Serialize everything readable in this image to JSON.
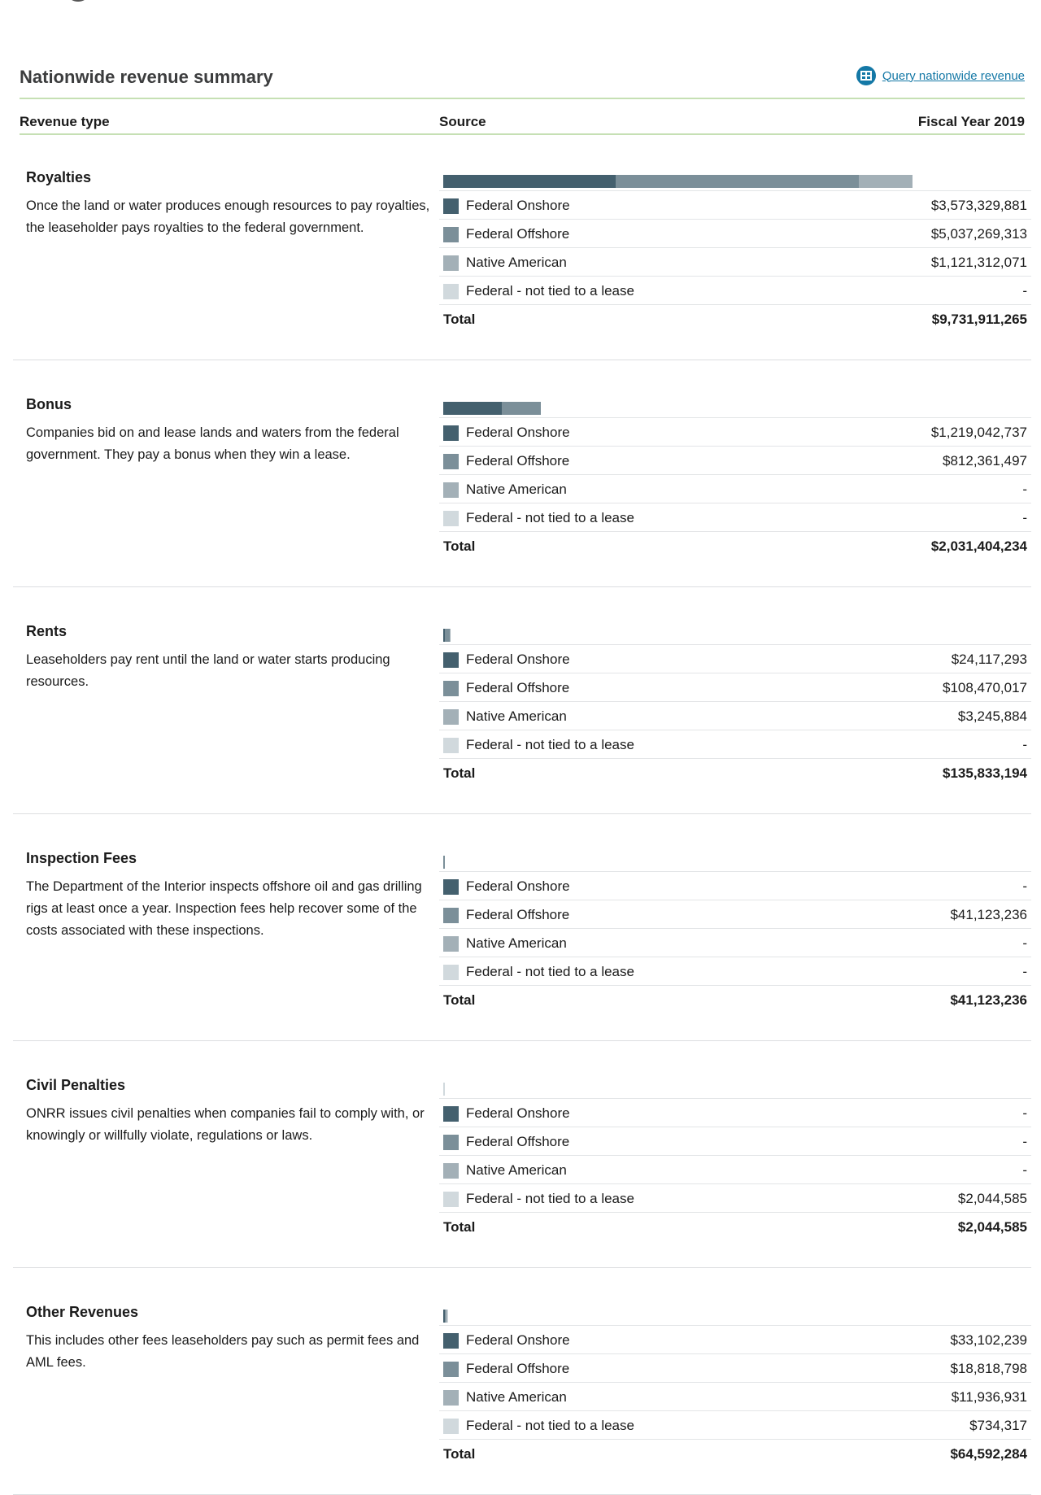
{
  "header": {
    "title": "Nationwide revenue summary",
    "query_link": "Query nationwide revenue"
  },
  "columns": {
    "type": "Revenue type",
    "source": "Source",
    "year": "Fiscal Year 2019"
  },
  "colors": {
    "federal_onshore": "#44606e",
    "federal_offshore": "#7b8f99",
    "native_american": "#a3b0b7",
    "federal_not_tied": "#d1d9dd",
    "header_rule": "#c6e0b4",
    "link": "#1478a6"
  },
  "max_total": 9731911265,
  "sections": [
    {
      "title": "Royalties",
      "desc": "Once the land or water produces enough resources to pay royalties, the leaseholder pays royalties to the federal government.",
      "rows": [
        {
          "label": "Federal Onshore",
          "display": "$3,573,329,881",
          "value": 3573329881
        },
        {
          "label": "Federal Offshore",
          "display": "$5,037,269,313",
          "value": 5037269313
        },
        {
          "label": "Native American",
          "display": "$1,121,312,071",
          "value": 1121312071
        },
        {
          "label": "Federal - not tied to a lease",
          "display": "-",
          "value": 0
        }
      ],
      "total_label": "Total",
      "total": "$9,731,911,265"
    },
    {
      "title": "Bonus",
      "desc": "Companies bid on and lease lands and waters from the federal government. They pay a bonus when they win a lease.",
      "rows": [
        {
          "label": "Federal Onshore",
          "display": "$1,219,042,737",
          "value": 1219042737
        },
        {
          "label": "Federal Offshore",
          "display": "$812,361,497",
          "value": 812361497
        },
        {
          "label": "Native American",
          "display": "-",
          "value": 0
        },
        {
          "label": "Federal - not tied to a lease",
          "display": "-",
          "value": 0
        }
      ],
      "total_label": "Total",
      "total": "$2,031,404,234"
    },
    {
      "title": "Rents",
      "desc": "Leaseholders pay rent until the land or water starts producing resources.",
      "rows": [
        {
          "label": "Federal Onshore",
          "display": "$24,117,293",
          "value": 24117293
        },
        {
          "label": "Federal Offshore",
          "display": "$108,470,017",
          "value": 108470017
        },
        {
          "label": "Native American",
          "display": "$3,245,884",
          "value": 3245884
        },
        {
          "label": "Federal - not tied to a lease",
          "display": "-",
          "value": 0
        }
      ],
      "total_label": "Total",
      "total": "$135,833,194"
    },
    {
      "title": "Inspection Fees",
      "desc": "The Department of the Interior inspects offshore oil and gas drilling rigs at least once a year. Inspection fees help recover some of the costs associated with these inspections.",
      "rows": [
        {
          "label": "Federal Onshore",
          "display": "-",
          "value": 0
        },
        {
          "label": "Federal Offshore",
          "display": "$41,123,236",
          "value": 41123236
        },
        {
          "label": "Native American",
          "display": "-",
          "value": 0
        },
        {
          "label": "Federal - not tied to a lease",
          "display": "-",
          "value": 0
        }
      ],
      "total_label": "Total",
      "total": "$41,123,236"
    },
    {
      "title": "Civil Penalties",
      "desc": "ONRR issues civil penalties when companies fail to comply with, or knowingly or willfully violate, regulations or laws.",
      "rows": [
        {
          "label": "Federal Onshore",
          "display": "-",
          "value": 0
        },
        {
          "label": "Federal Offshore",
          "display": "-",
          "value": 0
        },
        {
          "label": "Native American",
          "display": "-",
          "value": 0
        },
        {
          "label": "Federal - not tied to a lease",
          "display": "$2,044,585",
          "value": 2044585
        }
      ],
      "total_label": "Total",
      "total": "$2,044,585"
    },
    {
      "title": "Other Revenues",
      "desc": "This includes other fees leaseholders pay such as permit fees and AML fees.",
      "rows": [
        {
          "label": "Federal Onshore",
          "display": "$33,102,239",
          "value": 33102239
        },
        {
          "label": "Federal Offshore",
          "display": "$18,818,798",
          "value": 18818798
        },
        {
          "label": "Native American",
          "display": "$11,936,931",
          "value": 11936931
        },
        {
          "label": "Federal - not tied to a lease",
          "display": "$734,317",
          "value": 734317
        }
      ],
      "total_label": "Total",
      "total": "$64,592,284"
    }
  ]
}
